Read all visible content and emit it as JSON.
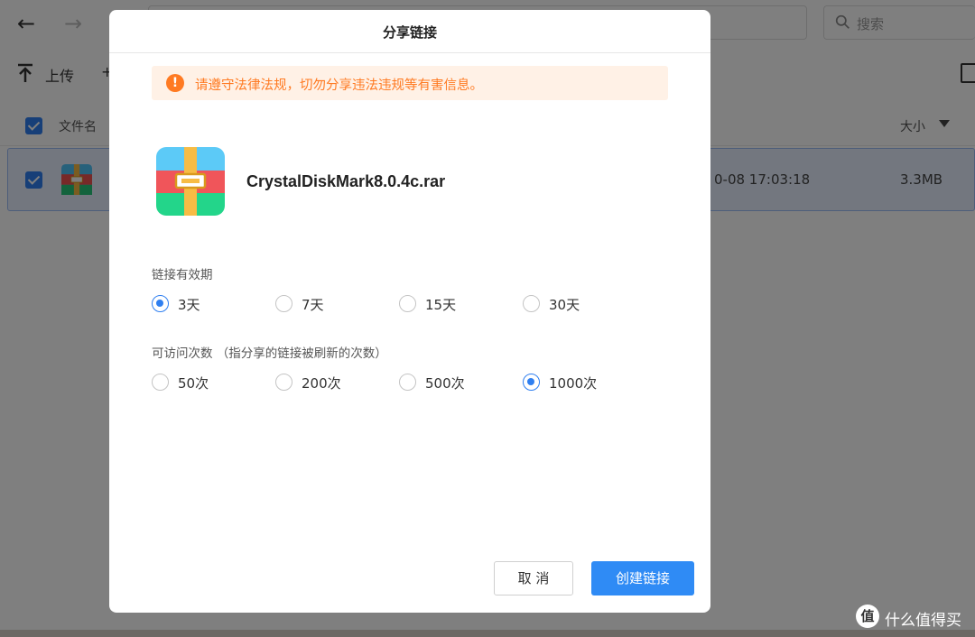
{
  "background": {
    "search_placeholder": "搜索",
    "toolbar": {
      "upload_label": "上传"
    },
    "list_header": {
      "name_col": "文件名",
      "size_col": "大小"
    },
    "file_row": {
      "date": "0-08 17:03:18",
      "size": "3.3MB"
    }
  },
  "dialog": {
    "title": "分享链接",
    "warning": "请遵守法律法规，切勿分享违法违规等有害信息。",
    "file_name": "CrystalDiskMark8.0.4c.rar",
    "expiry": {
      "label": "链接有效期",
      "options": [
        "3天",
        "7天",
        "15天",
        "30天"
      ],
      "selected": "3天"
    },
    "visits": {
      "label": "可访问次数 （指分享的链接被刷新的次数）",
      "options": [
        "50次",
        "200次",
        "500次",
        "1000次"
      ],
      "selected": "1000次"
    },
    "buttons": {
      "cancel": "取 消",
      "create": "创建链接"
    }
  },
  "watermark": {
    "text": "什么值得买",
    "logo": "值"
  },
  "colors": {
    "accent": "#2f7ff0",
    "warning": "#ff7a22",
    "warning_bg": "#fff1e6"
  },
  "icons": [
    "back-arrow-icon",
    "forward-arrow-icon",
    "search-icon",
    "upload-icon",
    "sort-down-icon",
    "warning-icon",
    "archive-file-icon"
  ]
}
